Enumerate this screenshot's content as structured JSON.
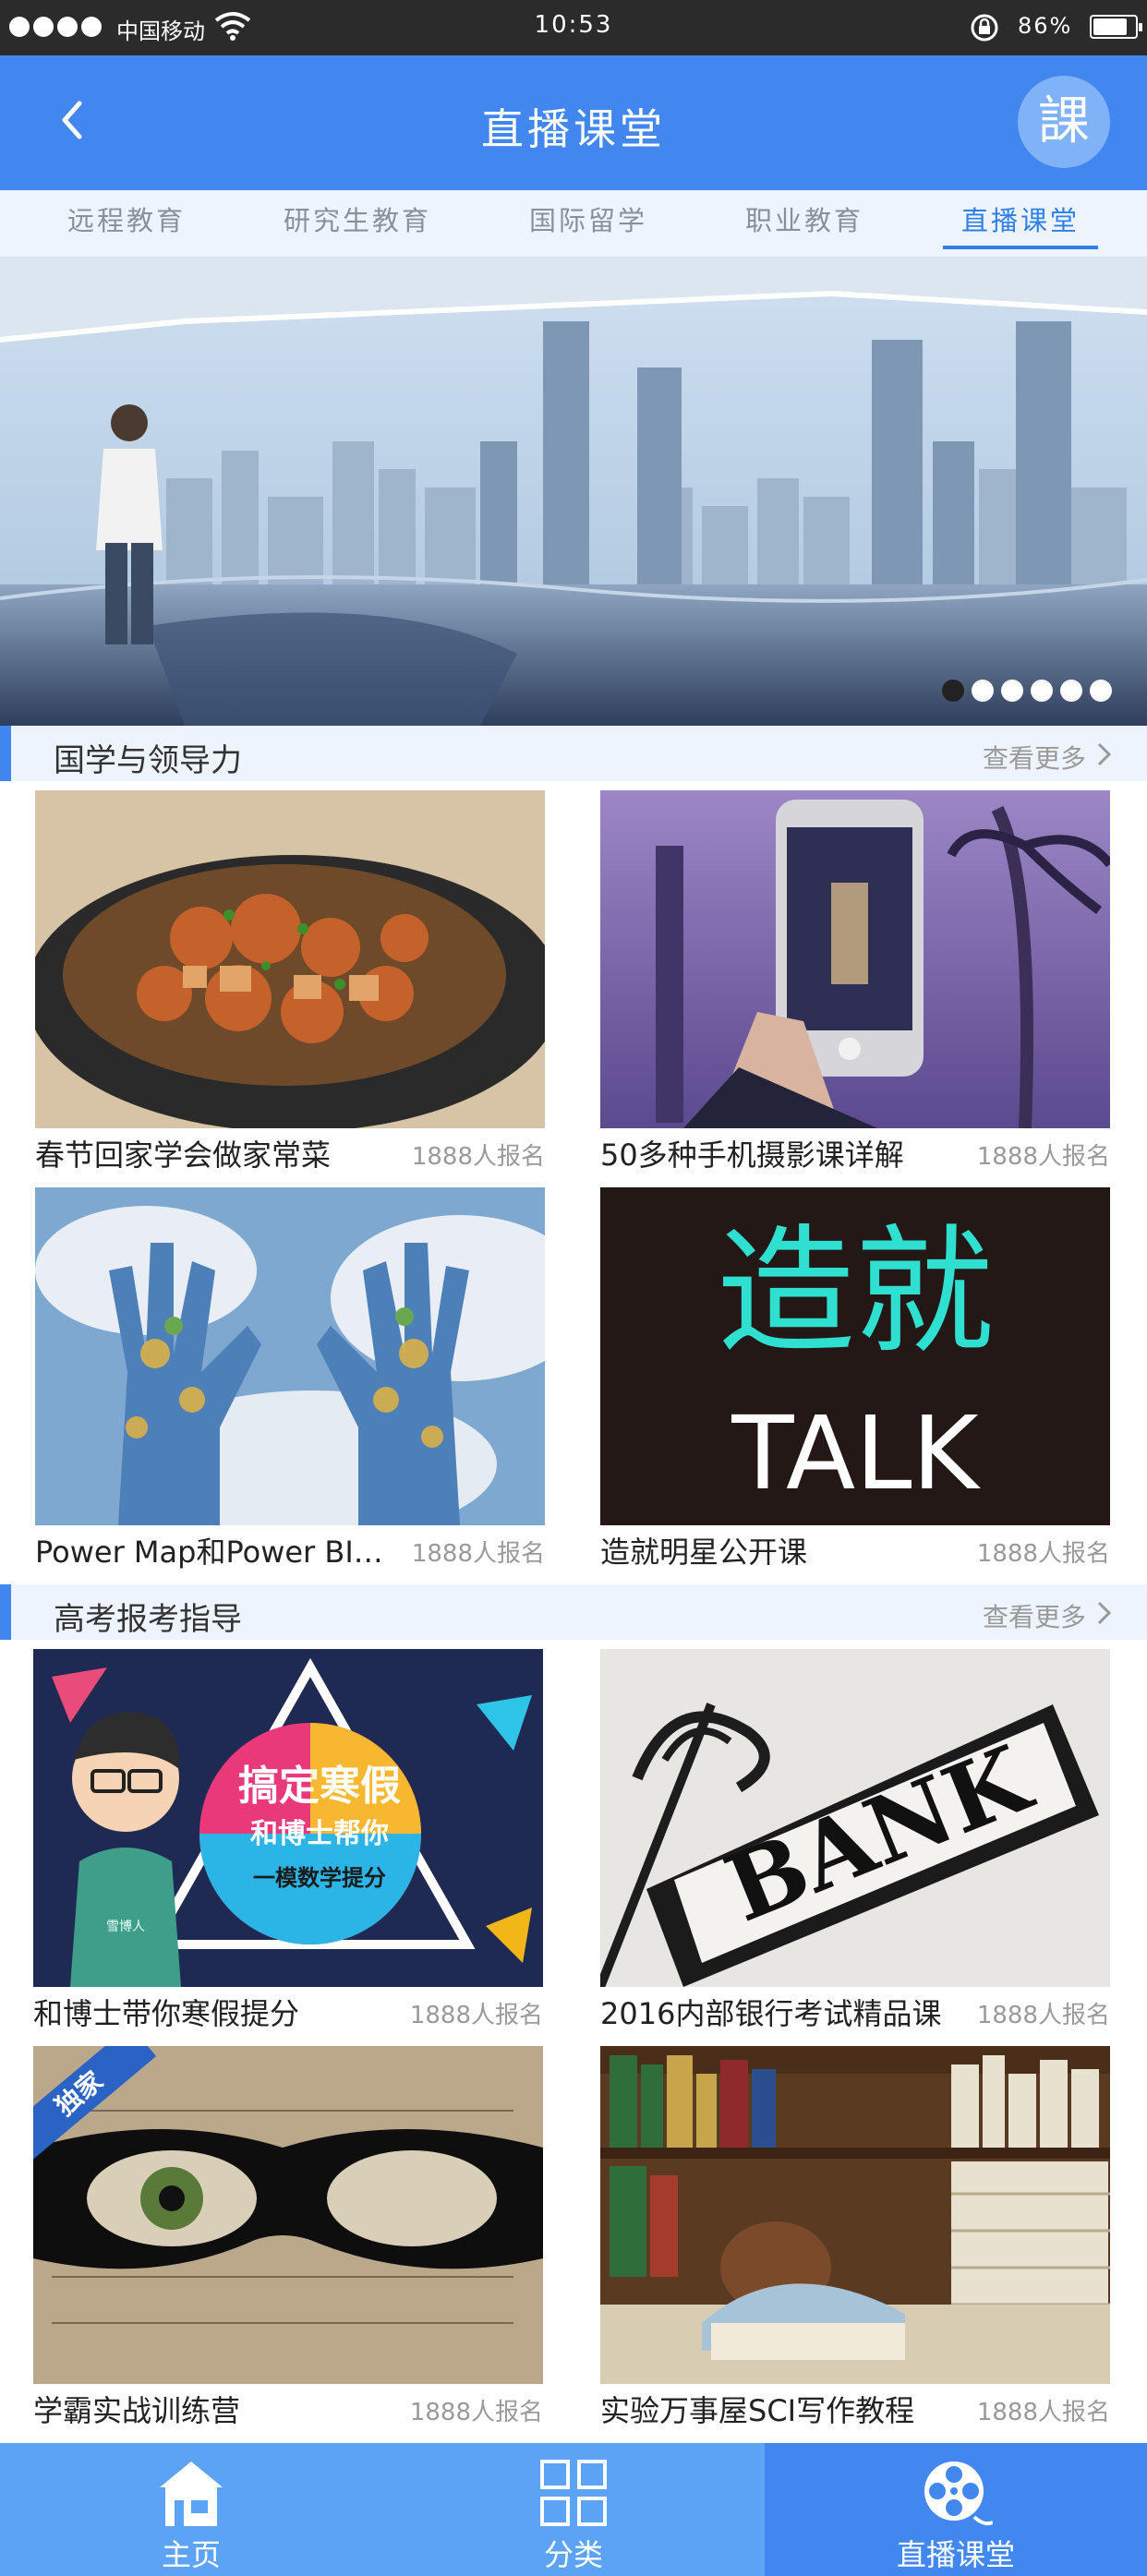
{
  "status_bar": {
    "carrier": "中国移动",
    "time": "10:53",
    "battery": "86%"
  },
  "header": {
    "title": "直播课堂",
    "logo_text": "課"
  },
  "tabs": [
    {
      "label": "远程教育"
    },
    {
      "label": "研究生教育"
    },
    {
      "label": "国际留学"
    },
    {
      "label": "职业教育"
    },
    {
      "label": "直播课堂",
      "active": true
    }
  ],
  "banner": {
    "slide_count": 6,
    "active_index": 0
  },
  "sections": [
    {
      "title": "国学与领导力",
      "more": "查看更多",
      "courses": [
        {
          "name": "春节回家学会做家常菜",
          "count": "1888人报名"
        },
        {
          "name": "50多种手机摄影课详解",
          "count": "1888人报名"
        },
        {
          "name": "Power Map和Power BI数据可视化",
          "count": "1888人报名"
        },
        {
          "name": "造就明星公开课",
          "count": "1888人报名",
          "image_text": [
            "造就",
            "TALK"
          ]
        }
      ]
    },
    {
      "title": "高考报考指导",
      "more": "查看更多",
      "courses": [
        {
          "name": "和博士带你寒假提分",
          "count": "1888人报名",
          "image_text": [
            "搞定寒假",
            "和博士帮你",
            "一模数学提分",
            "雪博人"
          ]
        },
        {
          "name": "2016内部银行考试精品课",
          "count": "1888人报名",
          "image_text": [
            "BANK"
          ]
        },
        {
          "name": "学霸实战训练营",
          "count": "1888人报名",
          "image_text": [
            "独家"
          ]
        },
        {
          "name": "实验万事屋SCI写作教程",
          "count": "1888人报名"
        }
      ]
    }
  ],
  "bottom_nav": [
    {
      "label": "主页",
      "icon": "home-icon"
    },
    {
      "label": "分类",
      "icon": "grid-icon"
    },
    {
      "label": "直播课堂",
      "icon": "film-reel-icon",
      "active": true
    }
  ],
  "colors": {
    "primary": "#4287ef",
    "nav_bg": "#5ca3f5",
    "tab_bg": "#eef4fd"
  }
}
